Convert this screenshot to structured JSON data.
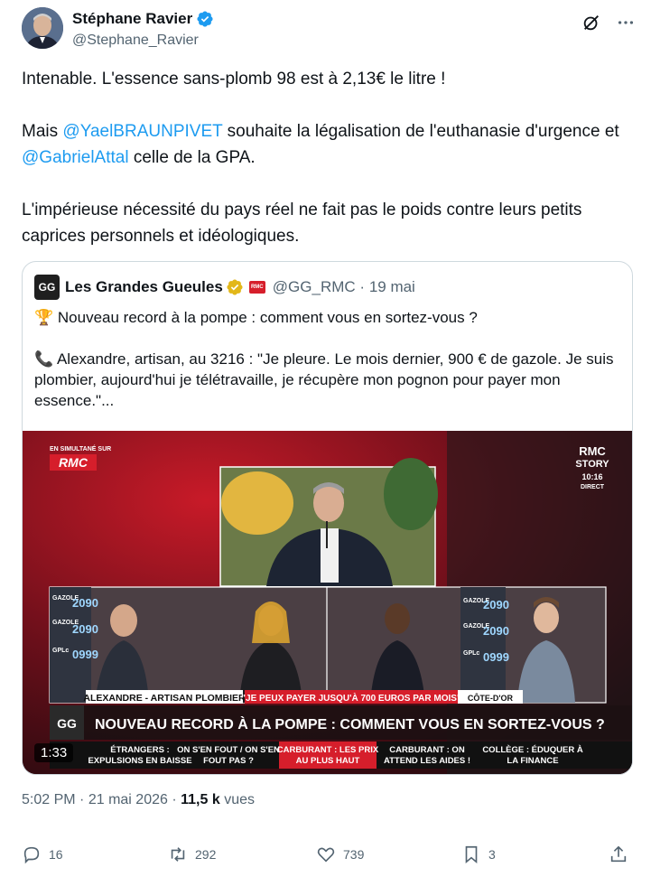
{
  "author": {
    "name": "Stéphane Ravier",
    "handle": "@Stephane_Ravier"
  },
  "tweet": {
    "line1": "Intenable. L'essence sans-plomb 98 est à 2,13€ le litre !",
    "line2_prefix": "Mais ",
    "mention1": "@YaelBRAUNPIVET",
    "line2_mid": " souhaite la légalisation de l'euthanasie d'urgence et ",
    "mention2": "@GabrielAttal",
    "line2_suffix": " celle de la GPA.",
    "line3": "L'impérieuse nécessité du pays réel ne fait pas le poids contre leurs petits caprices personnels et idéologiques."
  },
  "quote": {
    "logo": "GG",
    "name": "Les Grandes Gueules",
    "rmc_badge": "RMC",
    "handle": "@GG_RMC",
    "separator": "·",
    "date": "19 mai",
    "line1": "🏆 Nouveau record à la pompe : comment vous en sortez-vous ?",
    "line2": "📞 Alexandre, artisan, au 3216 : \"Je pleure. Le mois dernier, 900 € de gazole. Je suis plombier, aujourd'hui je télétravaille, je récupère mon pognon pour payer mon essence.\"..."
  },
  "video": {
    "duration": "1:33",
    "simulcast": "EN SIMULTANÉ SUR",
    "simulcast_brand": "RMC",
    "story_line1": "RMC",
    "story_line2": "STORY",
    "story_time": "10:16",
    "story_direct": "DIRECT",
    "caller": "ALEXANDRE - ARTISAN PLOMBIER",
    "quote_banner": "\"JE PEUX PAYER JUSQU'À 700 EUROS PAR MOIS\"",
    "region": "CÔTE-D'OR",
    "headline": "NOUVEAU RECORD À LA POMPE : COMMENT VOUS EN SORTEZ-VOUS ?",
    "ticker": [
      [
        "ÉTRANGERS :",
        "EXPULSIONS EN BAISSE"
      ],
      [
        "ON S'EN FOUT / ON S'EN",
        "FOUT PAS ?"
      ],
      [
        "CARBURANT : LES PRIX",
        "AU PLUS HAUT"
      ],
      [
        "CARBURANT : ON",
        "ATTEND LES AIDES !"
      ],
      [
        "COLLÈGE : ÉDUQUER À",
        "LA FINANCE"
      ]
    ],
    "pump_labels": [
      "GAZOLE",
      "GAZOLE",
      "GPLc",
      "GAZOLE",
      "GAZOLE",
      "GPLc"
    ],
    "pump_prices": [
      "2090",
      "2090",
      "0999",
      "2090",
      "2090",
      "0999"
    ]
  },
  "meta": {
    "time": "5:02 PM",
    "separator": "·",
    "date": "21 mai 2026",
    "views": "11,5 k",
    "views_label": "vues"
  },
  "actions": {
    "replies": "16",
    "reposts": "292",
    "likes": "739",
    "bookmarks": "3"
  },
  "colors": {
    "mention": "#1d9bf0",
    "verified": "#1d9bf0",
    "gold_badge": "#e2b719",
    "rmc_red": "#d61e2b"
  }
}
